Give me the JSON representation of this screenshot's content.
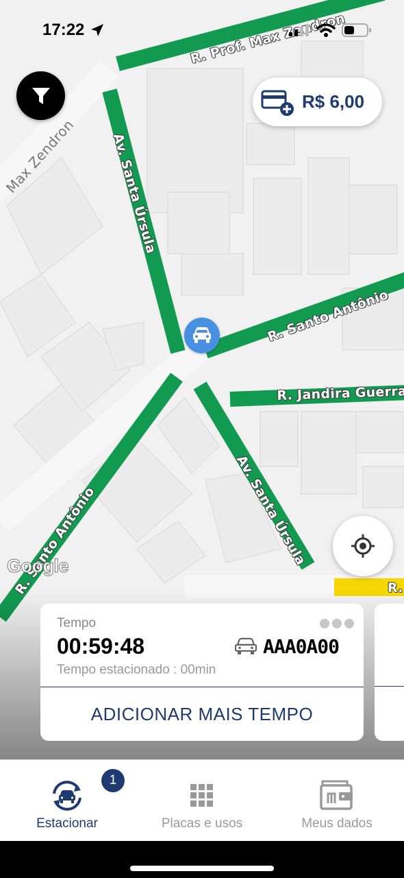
{
  "status_bar": {
    "time": "17:22"
  },
  "map": {
    "streets": {
      "prof_max_zendron": "R. Prof. Max Zendron",
      "max_zendron": "Max Zendron",
      "santa_ursula_top": "Av. Santa Úrsula",
      "santo_antonio_right": "R. Santo Antônio",
      "jandira_guerra": "R. Jandira Guerra",
      "santa_ursula_bottom": "Av. Santa Úrsula",
      "santo_antonio_left": "R. Santo Antônio",
      "r_edge": "R."
    },
    "logo": "Google"
  },
  "balance": {
    "value": "R$ 6,00"
  },
  "parking_card": {
    "label": "Tempo",
    "timer": "00:59:48",
    "plate": "AAA0A00",
    "parked": "Tempo estacionado : 00min",
    "action": "ADICIONAR MAIS TEMPO"
  },
  "tabbar": {
    "items": [
      {
        "label": "Estacionar",
        "badge": "1"
      },
      {
        "label": "Placas e usos"
      },
      {
        "label": "Meus dados"
      }
    ]
  },
  "colors": {
    "primary": "#1e3a70",
    "street_green": "#129a50",
    "marker_blue": "#4a90e2",
    "street_yellow": "#f6d705"
  }
}
